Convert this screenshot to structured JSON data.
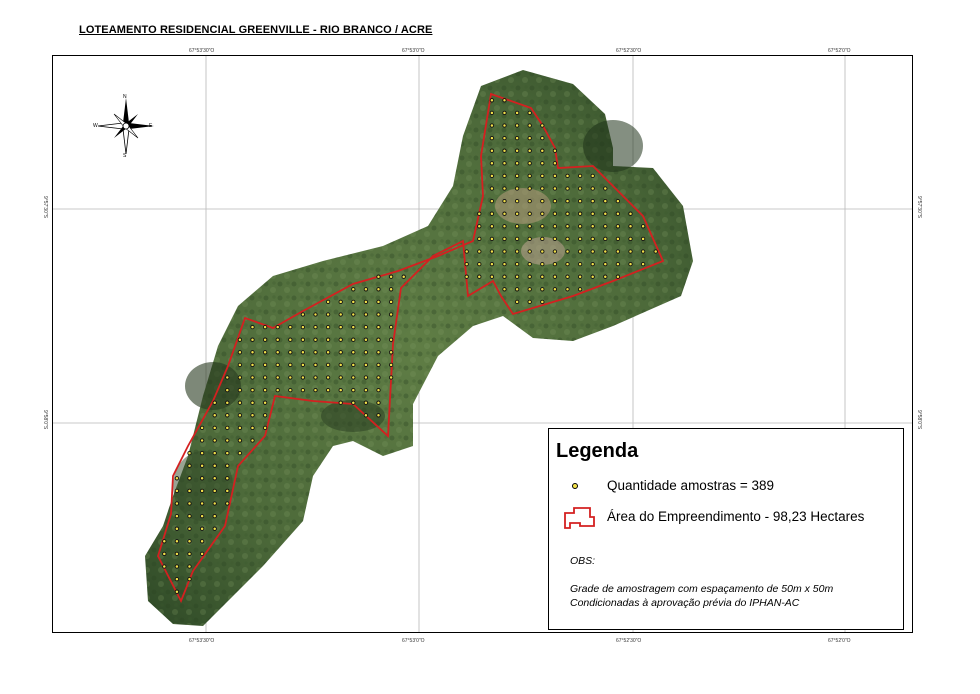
{
  "title": "LOTEAMENTO RESIDENCIAL GREENVILLE - RIO BRANCO / ACRE",
  "grid": {
    "lon_labels": [
      "67°53'30\"O",
      "67°53'0\"O",
      "67°52'30\"O",
      "67°52'0\"O"
    ],
    "lat_labels": [
      "9°57'30\"S",
      "9°58'0\"S"
    ]
  },
  "compass": {
    "n": "N",
    "s": "S",
    "e": "E",
    "w": "W"
  },
  "legend": {
    "title": "Legenda",
    "samples_label": "Quantidade amostras = 389",
    "area_label": "Área do Empreendimento - 98,23 Hectares",
    "obs_title": "OBS:",
    "obs_line1": "Grade de amostragem com espaçamento de 50m x 50m",
    "obs_line2": "Condicionadas à aprovação prévia do IPHAN-AC"
  },
  "colors": {
    "boundary": "#d42020",
    "sample_fill": "#f2e14a",
    "sample_stroke": "#111111",
    "vegetation_dark": "#2e4a25",
    "vegetation_light": "#6e8a55"
  }
}
